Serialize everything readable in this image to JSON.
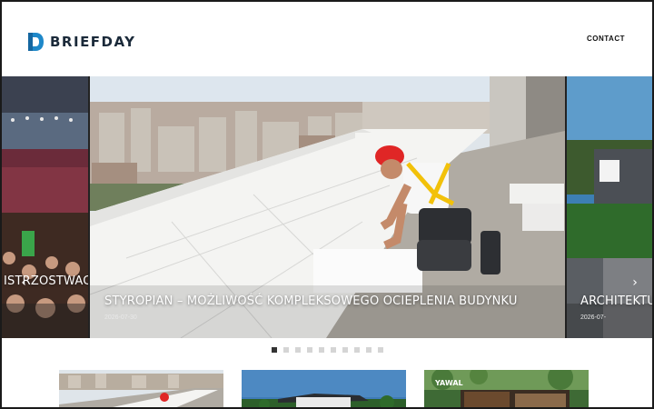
{
  "site": {
    "brand": "BRIEFDAY",
    "nav_contact": "CONTACT"
  },
  "slider": {
    "prev_icon": "chevron-left-icon",
    "next_icon": "chevron-right-icon",
    "slides": [
      {
        "title": "ISTRZOSTWACH",
        "date": ""
      },
      {
        "title": "STYROPIAN – MOŻLIWOŚĆ KOMPLEKSOWEGO OCIEPLENIA BUDYNKU",
        "date": "2026-07-30"
      },
      {
        "title": "ARCHITEKTURA",
        "date": "2026-07-"
      }
    ],
    "dots_total": 10,
    "dots_active": 0
  },
  "thumbs": [
    {
      "label": ""
    },
    {
      "label": ""
    },
    {
      "label": "YAWAL"
    }
  ],
  "colors": {
    "accent": "#1e88c9",
    "brand_text": "#1b2a3a",
    "sky": "#dfe7ee",
    "dot_active": "#333333"
  }
}
